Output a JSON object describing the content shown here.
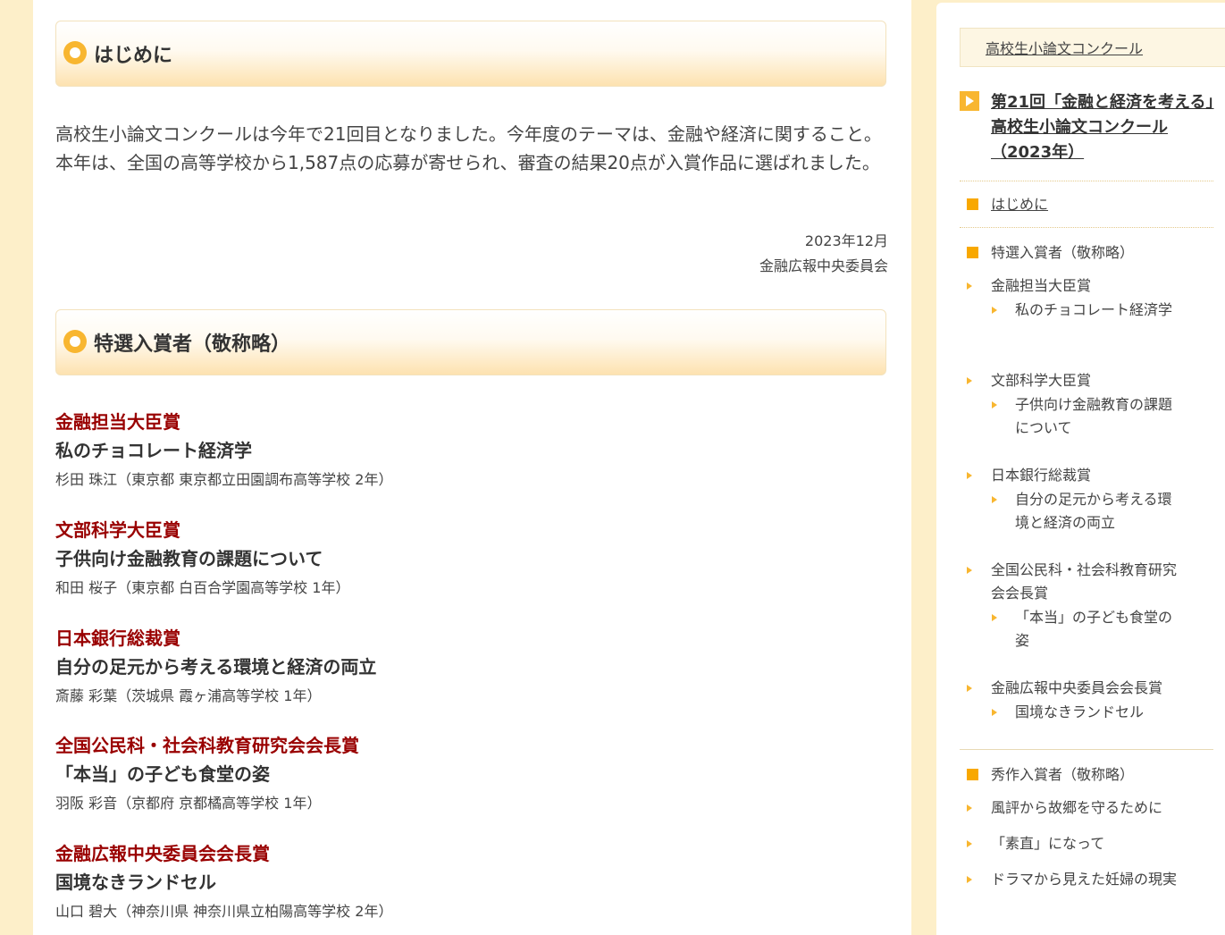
{
  "main": {
    "section1": {
      "title": "はじめに"
    },
    "intro": "高校生小論文コンクールは今年で21回目となりました。今年度のテーマは、金融や経済に関すること。本年は、全国の高等学校から1,587点の応募が寄せられ、審査の結果20点が入賞作品に選ばれました。",
    "date": "2023年12月",
    "org": "金融広報中央委員会",
    "section2": {
      "title": "特選入賞者（敬称略）"
    },
    "awards": [
      {
        "award": "金融担当大臣賞",
        "title": "私のチョコレート経済学",
        "winner": "杉田 珠江（東京都 東京都立田園調布高等学校 2年）"
      },
      {
        "award": "文部科学大臣賞",
        "title": "子供向け金融教育の課題について",
        "winner": "和田 桜子（東京都 白百合学園高等学校 1年）"
      },
      {
        "award": "日本銀行総裁賞",
        "title": "自分の足元から考える環境と経済の両立",
        "winner": "斎藤 彩葉（茨城県 霞ヶ浦高等学校 1年）"
      },
      {
        "award": "全国公民科・社会科教育研究会会長賞",
        "title": "「本当」の子ども食堂の姿",
        "winner": "羽阪 彩音（京都府 京都橘高等学校 1年）"
      },
      {
        "award": "金融広報中央委員会会長賞",
        "title": "国境なきランドセル",
        "winner": "山口 碧大（神奈川県 神奈川県立柏陽高等学校 2年）"
      }
    ]
  },
  "sidebar": {
    "breadcrumb": "高校生小論文コンクール",
    "current": "第21回「金融と経済を考える」高校生小論文コンクール（2023年）",
    "intro_link": "はじめに",
    "special_heading": "特選入賞者（敬称略）",
    "special": [
      {
        "award": "金融担当大臣賞",
        "title": "私のチョコレート経済学"
      },
      {
        "award": "文部科学大臣賞",
        "title": "子供向け金融教育の課題について"
      },
      {
        "award": "日本銀行総裁賞",
        "title": "自分の足元から考える環境と経済の両立"
      },
      {
        "award": "全国公民科・社会科教育研究会会長賞",
        "title": "「本当」の子ども食堂の姿"
      },
      {
        "award": "金融広報中央委員会会長賞",
        "title": "国境なきランドセル"
      }
    ],
    "excellent_heading": "秀作入賞者（敬称略）",
    "excellent": [
      "風評から故郷を守るために",
      "「素直」になって",
      "ドラマから見えた妊婦の現実"
    ]
  }
}
